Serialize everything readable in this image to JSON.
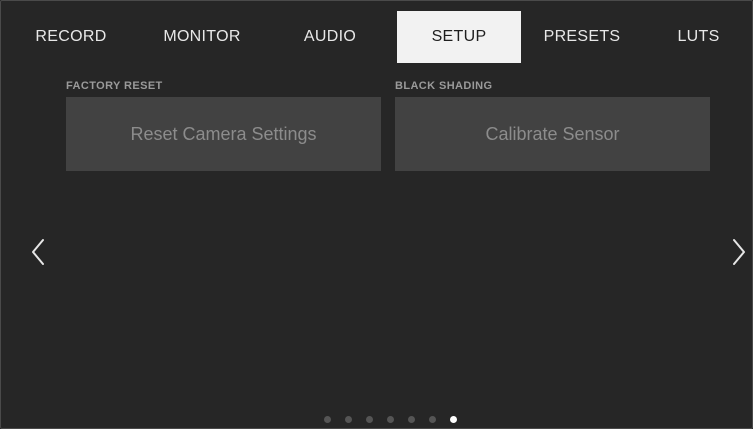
{
  "tabs": [
    {
      "label": "RECORD",
      "active": false
    },
    {
      "label": "MONITOR",
      "active": false
    },
    {
      "label": "AUDIO",
      "active": false
    },
    {
      "label": "SETUP",
      "active": true
    },
    {
      "label": "PRESETS",
      "active": false
    },
    {
      "label": "LUTS",
      "active": false
    }
  ],
  "settings": {
    "factory_reset": {
      "label": "FACTORY RESET",
      "button": "Reset Camera Settings"
    },
    "black_shading": {
      "label": "BLACK SHADING",
      "button": "Calibrate Sensor"
    }
  },
  "navigation": {
    "prev_icon": "chevron-left-icon",
    "next_icon": "chevron-right-icon"
  },
  "pager": {
    "page_count": 7,
    "current_page": 7
  },
  "colors": {
    "background": "#262626",
    "active_tab_bg": "#f2f2f2",
    "button_bg": "#424242",
    "active_dot": "#ffffff",
    "inactive_dot": "#555555"
  }
}
